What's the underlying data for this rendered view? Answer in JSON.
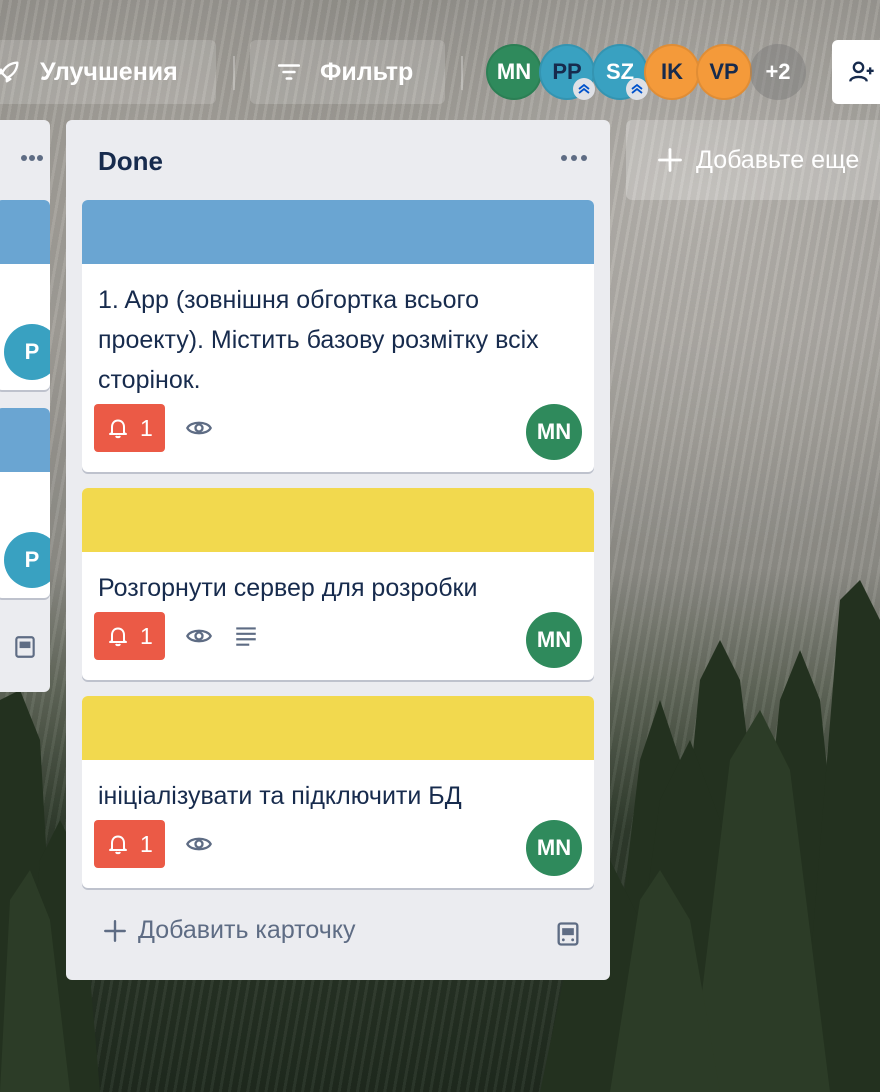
{
  "header": {
    "upgrades_label": "Улучшения",
    "filter_label": "Фильтр",
    "members": [
      {
        "initials": "MN",
        "color": "#2f8a5c",
        "admin": false
      },
      {
        "initials": "PP",
        "color": "#39a1c1",
        "admin": true
      },
      {
        "initials": "SZ",
        "color": "#39a1c1",
        "admin": true
      },
      {
        "initials": "IK",
        "color": "#f49a3a",
        "admin": false
      },
      {
        "initials": "VP",
        "color": "#f49a3a",
        "admin": false
      }
    ],
    "more_members": "+2"
  },
  "prev_list": {
    "avatar_initial": "P"
  },
  "done_list": {
    "title": "Done",
    "cards": [
      {
        "cover_color": "#6aa5d2",
        "title": "1. App (зовнішня обгортка всього проекту). Містить базову розмітку всіх сторінок.",
        "due_count": "1",
        "has_description": false,
        "member": "MN"
      },
      {
        "cover_color": "#f2d94e",
        "title": "Розгорнути сервер для розробки",
        "due_count": "1",
        "has_description": true,
        "member": "MN"
      },
      {
        "cover_color": "#f2d94e",
        "title": "ініціалізувати та підключити БД",
        "due_count": "1",
        "has_description": false,
        "member": "MN"
      }
    ],
    "add_card_label": "Добавить карточку"
  },
  "add_list_label": "Добавьте еще"
}
